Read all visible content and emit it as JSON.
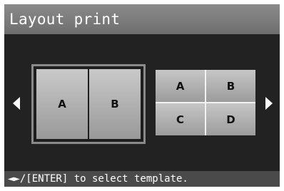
{
  "title": "Layout print",
  "templates": [
    {
      "name": "2-up",
      "selected": true,
      "cells": [
        "A",
        "B"
      ]
    },
    {
      "name": "4-up",
      "selected": false,
      "cells": [
        "A",
        "B",
        "C",
        "D"
      ]
    }
  ],
  "nav": {
    "left_icon": "left-triangle",
    "right_icon": "right-triangle"
  },
  "hint": "◄►/[ENTER] to select template.",
  "colors": {
    "screen_bg": "#222222",
    "title_bar": "#7c7c7c",
    "selection_border": "#8a8a8a",
    "bottom_bar": "#4a4a4a",
    "text": "#ffffff"
  }
}
